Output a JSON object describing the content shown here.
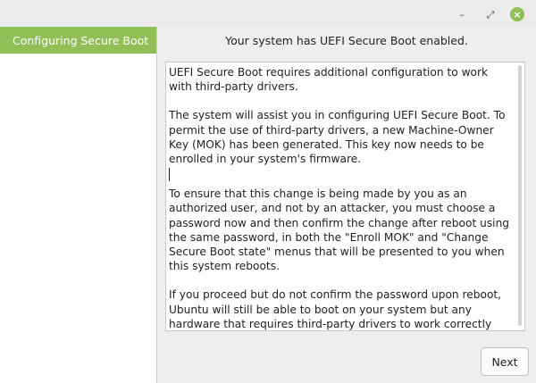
{
  "window": {
    "minimize_glyph": "–",
    "maximize_glyph": "⤢",
    "close_glyph": "×"
  },
  "sidebar": {
    "items": [
      {
        "label": "Configuring Secure Boot",
        "active": true
      }
    ]
  },
  "main": {
    "header": "Your system has UEFI Secure Boot enabled.",
    "paragraphs": [
      "UEFI Secure Boot requires additional configuration to work with third-party drivers.",
      "The system will assist you in configuring UEFI Secure Boot. To permit the use of third-party drivers, a new Machine-Owner Key (MOK) has been generated. This key now needs to be enrolled in your system's firmware.",
      "To ensure that this change is being made by you as an authorized user, and not by an attacker, you must choose a password now and then confirm the change after reboot using the same password, in both the \"Enroll MOK\" and \"Change Secure Boot state\" menus that will be presented to you when this system reboots.",
      "If you proceed but do not confirm the password upon reboot, Ubuntu will still be able to boot on your system but any hardware that requires third-party drivers to work correctly may not be usable."
    ]
  },
  "footer": {
    "next_label": "Next"
  },
  "colors": {
    "accent": "#8fbf56",
    "background": "#efefef"
  }
}
